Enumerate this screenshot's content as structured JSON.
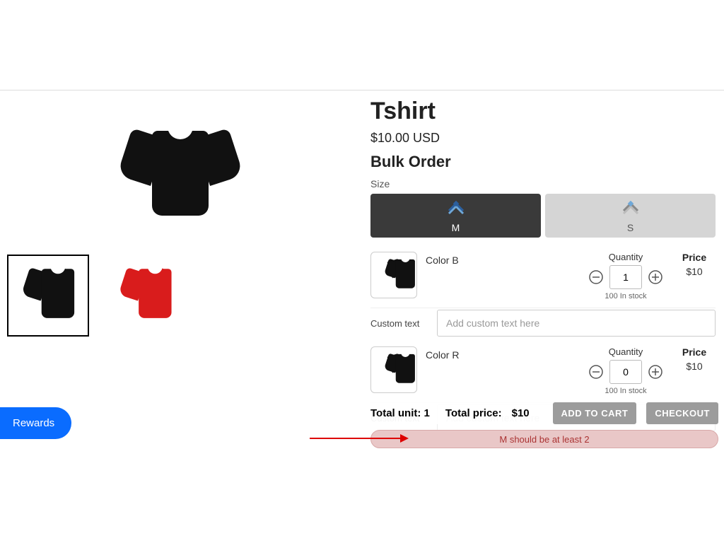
{
  "product": {
    "title": "Tshirt",
    "price_display": "$10.00 USD",
    "bulk_label": "Bulk Order",
    "size_label": "Size"
  },
  "tabs": [
    {
      "label": "M",
      "selected": true
    },
    {
      "label": "S",
      "selected": false
    }
  ],
  "headers": {
    "quantity": "Quantity",
    "price": "Price",
    "custom_text_label": "Custom text",
    "custom_text_placeholder": "Add custom text here"
  },
  "variants": [
    {
      "color_name": "Color  B",
      "quantity": "1",
      "stock": "100 In stock",
      "price": "$10"
    },
    {
      "color_name": "Color  R",
      "quantity": "0",
      "stock": "100 In stock",
      "price": "$10"
    }
  ],
  "summary": {
    "total_unit_label": "Total unit:",
    "total_unit_value": "1",
    "total_price_label": "Total price:",
    "total_price_value": "$10",
    "add_to_cart": "ADD TO CART",
    "checkout": "CHECKOUT"
  },
  "error_message": "M should be at least 2",
  "rewards_label": "Rewards"
}
